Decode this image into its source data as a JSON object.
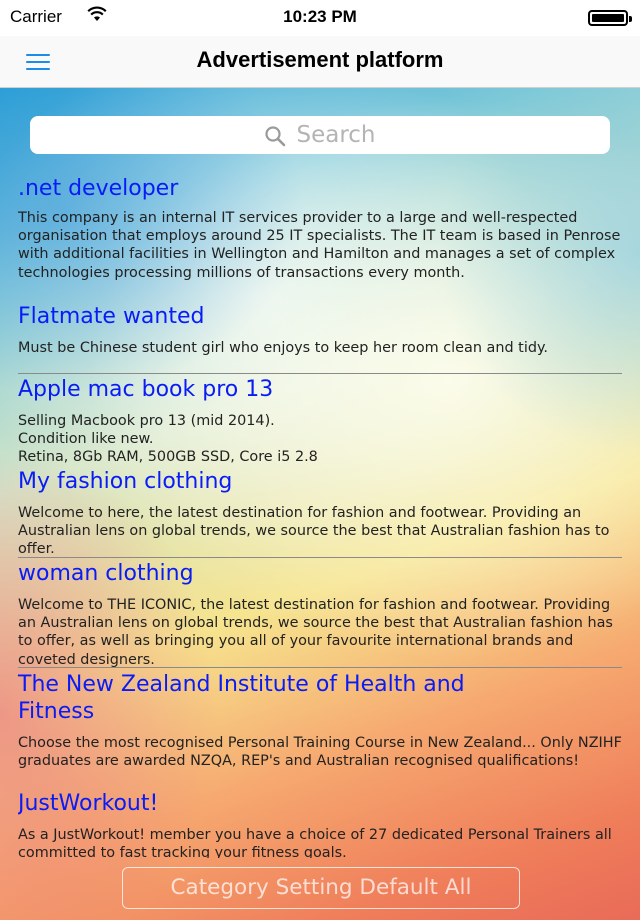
{
  "status": {
    "carrier": "Carrier",
    "time": "10:23 PM"
  },
  "nav": {
    "title": "Advertisement platform",
    "menu_icon": "hamburger-menu-icon"
  },
  "search": {
    "placeholder": "Search",
    "icon": "search-icon"
  },
  "listings": [
    {
      "title": ".net developer",
      "description": "This company is an internal IT services provider to a large and well-respected organisation that employs around 25 IT specialists. The IT team is based in Penrose with additional facilities in Wellington and Hamilton and manages a set of complex technologies processing millions of transactions every month."
    },
    {
      "title": "Flatmate wanted",
      "description": "Must be Chinese student girl who enjoys to keep her room clean and tidy."
    },
    {
      "title": "Apple mac book pro 13",
      "description": "Selling Macbook pro 13 (mid 2014).\nCondition like new.\nRetina, 8Gb RAM, 500GB SSD, Core i5 2.8"
    },
    {
      "title": "My fashion clothing",
      "description": "Welcome to here, the latest destination for fashion and footwear. Providing an Australian lens on global trends, we source the best that Australian fashion has to offer."
    },
    {
      "title": "woman clothing",
      "description": "Welcome to THE ICONIC, the latest destination for fashion and footwear. Providing an Australian lens on global trends, we source the best that Australian fashion has to offer, as well as bringing you all of your favourite international brands and coveted designers."
    },
    {
      "title": "The New Zealand Institute of Health and\nFitness",
      "description": "Choose the most recognised Personal Training Course in New Zealand... Only NZIHF graduates are awarded NZQA, REP's and Australian recognised qualifications!"
    },
    {
      "title": "JustWorkout!",
      "description": "As a JustWorkout! member you have a choice of 27 dedicated Personal Trainers all committed to fast tracking your fitness goals."
    }
  ],
  "bottom": {
    "category_button": "Category Setting Default All"
  },
  "colors": {
    "accent": "#1c8bea",
    "link": "#0a1cf5"
  }
}
